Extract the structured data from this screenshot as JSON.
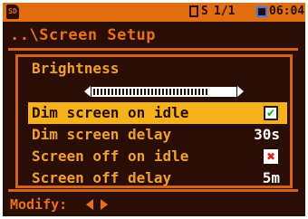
{
  "status_bar": {
    "card_icon": "sd-card-icon",
    "card_text": "SD",
    "memory_icon": "memory-icon",
    "setup_text": "S",
    "page_text": "1/1",
    "battery_icon": "battery-icon",
    "time_text": "06:04"
  },
  "title": "..\\Screen Setup",
  "brightness": {
    "label": "Brightness",
    "level": 0.82
  },
  "rows": [
    {
      "label": "Dim screen on idle",
      "selected": true,
      "checked": true
    },
    {
      "label": "Dim screen delay",
      "value": "30s"
    },
    {
      "label": "Screen off on idle",
      "checked": false
    },
    {
      "label": "Screen off delay",
      "value": "5m"
    }
  ],
  "footer": {
    "label": "Modify:",
    "left_icon": "arrow-left-icon",
    "right_icon": "arrow-right-icon"
  },
  "colors": {
    "background": "#2a0d03",
    "accent": "#e06d12",
    "highlight": "#f5b21a",
    "text": "#f0a030"
  }
}
